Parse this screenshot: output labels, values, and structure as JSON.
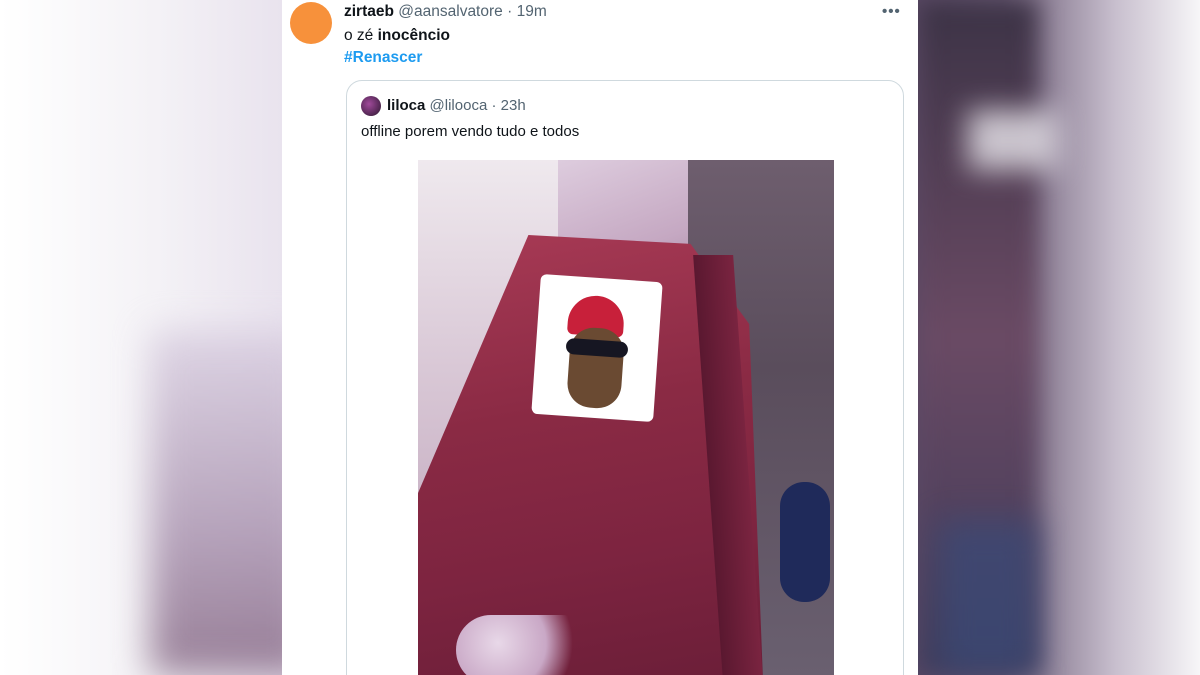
{
  "tweet": {
    "author_name": "zirtaeb",
    "author_handle": "@aansalvatore",
    "separator": "·",
    "time": "19m",
    "more_icon": "ellipsis-icon",
    "text_prefix": "o zé",
    "text_bold": "inocêncio",
    "hashtag": "#Renascer",
    "avatar_color": "#f7913b"
  },
  "quoted_tweet": {
    "author_name": "liloca",
    "author_handle": "@lilooca",
    "separator": "·",
    "time": "23h",
    "text": "offline porem vendo tudo e todos"
  },
  "colors": {
    "hashtag": "#1d9bf0",
    "secondary_text": "#536471",
    "primary_text": "#0f1419",
    "border": "#cfd9de"
  }
}
